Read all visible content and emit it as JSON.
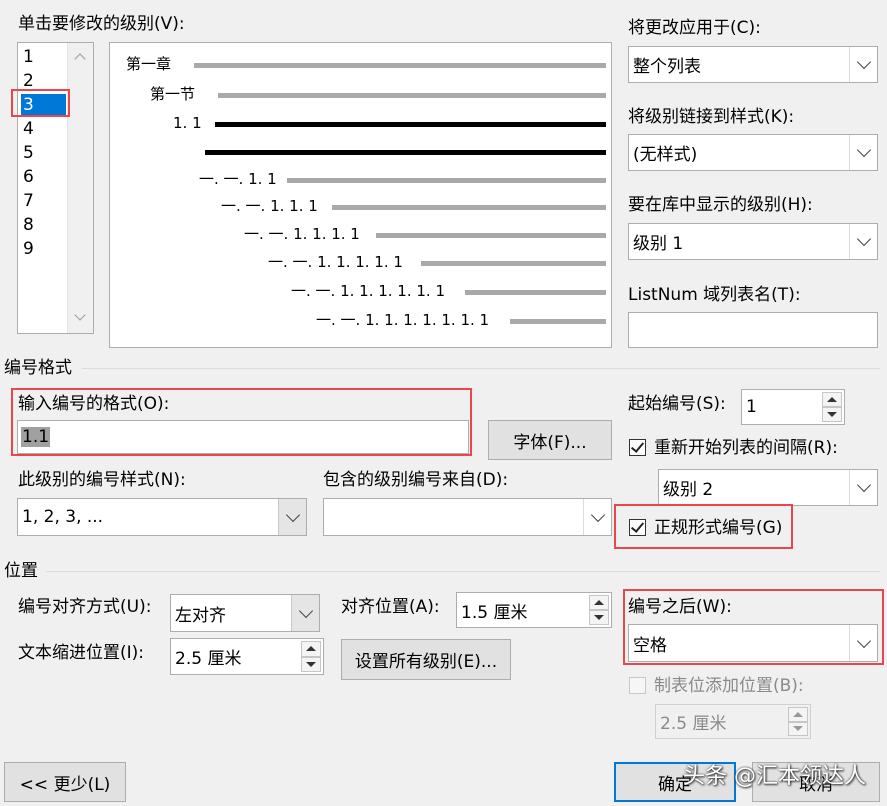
{
  "levels_section": {
    "label": "单击要修改的级别(V):",
    "levels": [
      "1",
      "2",
      "3",
      "4",
      "5",
      "6",
      "7",
      "8",
      "9"
    ],
    "selected": "3"
  },
  "preview": {
    "rows": [
      {
        "text": "第一章"
      },
      {
        "text": "第一节"
      },
      {
        "text": "1. 1"
      },
      {
        "text": ""
      },
      {
        "text": "一. 一. 1. 1"
      },
      {
        "text": "一. 一. 1. 1. 1"
      },
      {
        "text": "一. 一. 1. 1. 1. 1"
      },
      {
        "text": "一. 一. 1. 1. 1. 1. 1"
      },
      {
        "text": "一. 一. 1. 1. 1. 1. 1. 1"
      },
      {
        "text": "一. 一. 1. 1. 1. 1. 1. 1. 1"
      }
    ]
  },
  "right_panel": {
    "apply_to_label": "将更改应用于(C):",
    "apply_to_value": "整个列表",
    "link_style_label": "将级别链接到样式(K):",
    "link_style_value": "(无样式)",
    "gallery_level_label": "要在库中显示的级别(H):",
    "gallery_level_value": "级别 1",
    "listnum_label": "ListNum 域列表名(T):",
    "listnum_value": ""
  },
  "number_format": {
    "section_title": "编号格式",
    "enter_format_label": "输入编号的格式(O):",
    "format_value": "1.1",
    "font_button": "字体(F)...",
    "style_label": "此级别的编号样式(N):",
    "style_value": "1, 2, 3, ...",
    "include_from_label": "包含的级别编号来自(D):",
    "include_from_value": "",
    "start_at_label": "起始编号(S):",
    "start_at_value": "1",
    "restart_label": "重新开始列表的间隔(R):",
    "restart_checked": true,
    "restart_value": "级别 2",
    "legal_label": "正规形式编号(G)",
    "legal_checked": true
  },
  "position": {
    "section_title": "位置",
    "alignment_label": "编号对齐方式(U):",
    "alignment_value": "左对齐",
    "aligned_at_label": "对齐位置(A):",
    "aligned_at_value": "1.5 厘米",
    "text_indent_label": "文本缩进位置(I):",
    "text_indent_value": "2.5 厘米",
    "set_all_button": "设置所有级别(E)...",
    "follow_label": "编号之后(W):",
    "follow_value": "空格",
    "tab_stop_label": "制表位添加位置(B):",
    "tab_stop_checked": false,
    "tab_stop_value": "2.5 厘米"
  },
  "footer": {
    "less_button": "<< 更少(L)",
    "ok_button": "确定",
    "cancel_button": "取消",
    "watermark": "头条 @汇本领达人"
  },
  "colors": {
    "highlight_red": "#e8474f",
    "selection_blue": "#0078d7"
  }
}
